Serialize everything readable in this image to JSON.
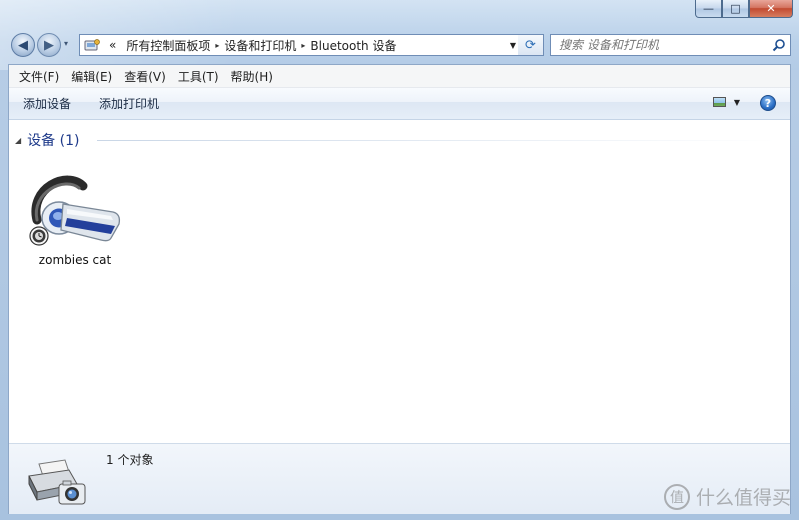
{
  "window": {
    "caption_buttons": {
      "minimize": "—",
      "maximize": "□",
      "close": "✕"
    }
  },
  "nav": {
    "back_glyph": "◀",
    "forward_glyph": "▶",
    "recent_glyph": "▾"
  },
  "address": {
    "prefix": "«",
    "breadcrumbs": [
      "所有控制面板项",
      "设备和打印机",
      "Bluetooth 设备"
    ],
    "separator": "▸",
    "dropdown_glyph": "▼",
    "refresh_glyph": "⟳"
  },
  "search": {
    "placeholder": "搜索 设备和打印机"
  },
  "menubar": {
    "items": [
      "文件(F)",
      "编辑(E)",
      "查看(V)",
      "工具(T)",
      "帮助(H)"
    ]
  },
  "toolbar": {
    "add_device": "添加设备",
    "add_printer": "添加打印机",
    "help_glyph": "?",
    "view_caret": "▼"
  },
  "group": {
    "title": "设备 (1)",
    "collapse_glyph": "◢"
  },
  "devices": [
    {
      "name": "zombies cat",
      "icon": "bluetooth-headset-icon"
    }
  ],
  "status": {
    "count": "1 个对象",
    "icon": "printer-camera-icon"
  },
  "watermark": {
    "glyph": "值",
    "text": "什么值得买"
  },
  "colors": {
    "accent": "#1e3a8a",
    "frame": "#b7cde6",
    "close": "#c24a31"
  }
}
